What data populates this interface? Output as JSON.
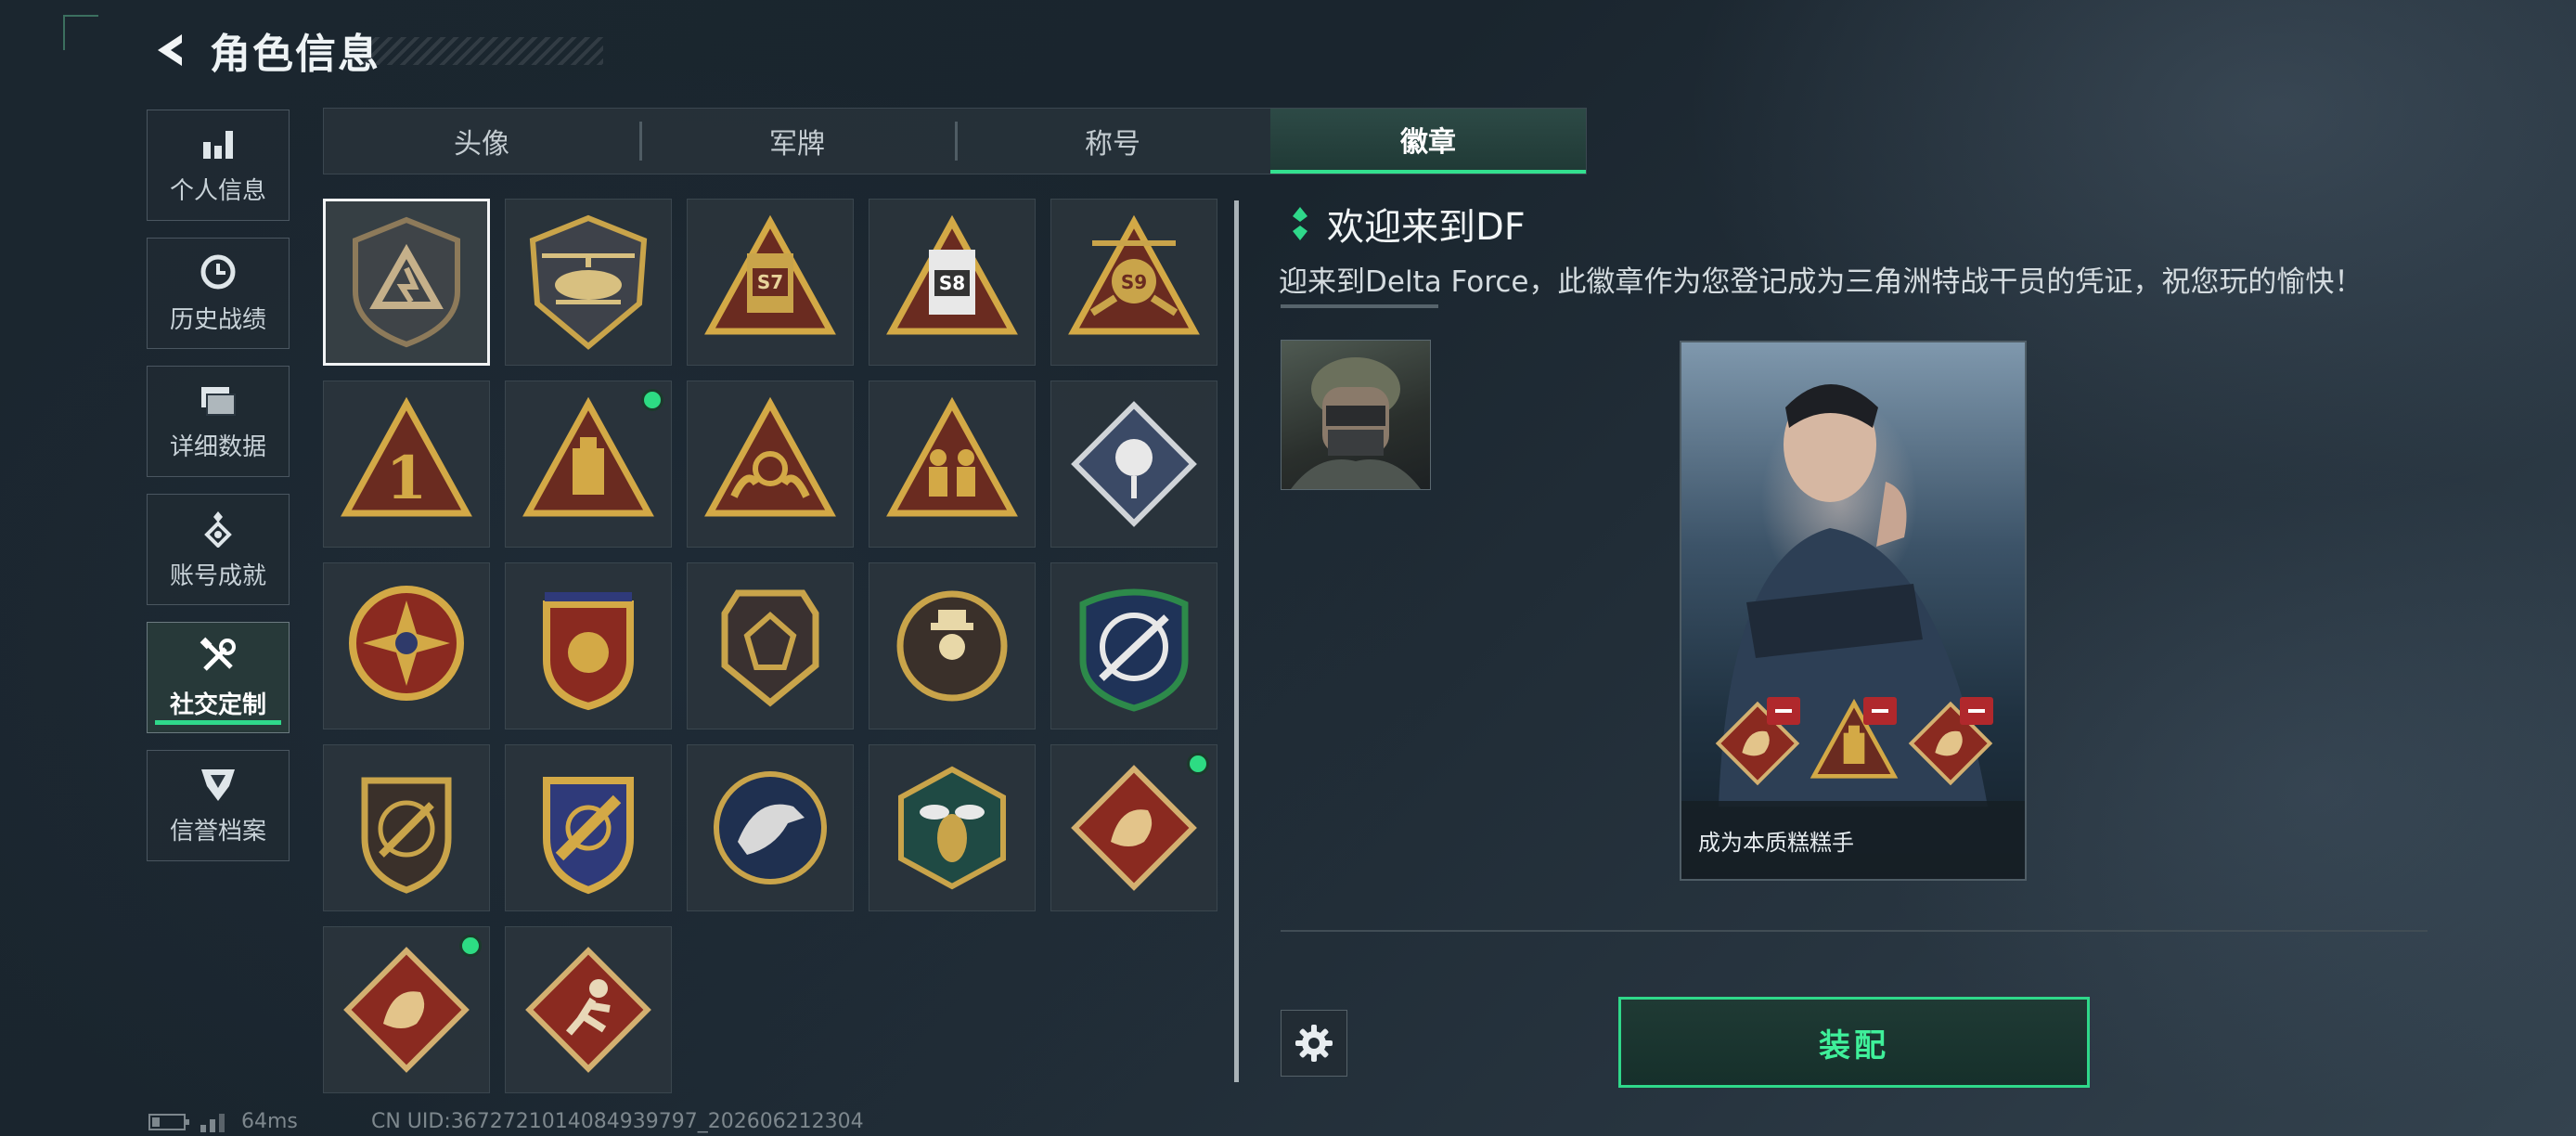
{
  "header": {
    "title": "角色信息"
  },
  "sidebar": {
    "items": [
      {
        "label": "个人信息",
        "icon": "bar-chart-icon"
      },
      {
        "label": "历史战绩",
        "icon": "history-clock-icon"
      },
      {
        "label": "详细数据",
        "icon": "folder-icon"
      },
      {
        "label": "账号成就",
        "icon": "achievement-icon"
      },
      {
        "label": "社交定制",
        "icon": "tools-icon",
        "active": true
      },
      {
        "label": "信誉档案",
        "icon": "shield-emblem-icon"
      }
    ]
  },
  "tabs": [
    {
      "label": "头像"
    },
    {
      "label": "军牌"
    },
    {
      "label": "称号"
    },
    {
      "label": "徽章",
      "active": true
    }
  ],
  "badges": [
    {
      "name": "delta-force-welcome-badge",
      "selected": true,
      "new": false
    },
    {
      "name": "helicopter-badge",
      "new": false
    },
    {
      "name": "s7-badge",
      "text": "S7",
      "new": false
    },
    {
      "name": "s8-badge",
      "text": "S8",
      "new": false
    },
    {
      "name": "s9-badge",
      "text": "S9",
      "new": false
    },
    {
      "name": "rank-1-badge",
      "text": "1",
      "new": false
    },
    {
      "name": "usb-triangle-badge",
      "new": true
    },
    {
      "name": "hands-triangle-badge",
      "new": false
    },
    {
      "name": "soldiers-triangle-badge",
      "new": false
    },
    {
      "name": "rose-diamond-badge",
      "new": false
    },
    {
      "name": "star-compass-badge",
      "new": false
    },
    {
      "name": "winged-crest-badge",
      "new": false
    },
    {
      "name": "gem-shield-badge",
      "new": false
    },
    {
      "name": "hat-figure-badge",
      "new": false
    },
    {
      "name": "crosshair-rifle-badge",
      "new": false
    },
    {
      "name": "rifle-shield-badge",
      "new": false
    },
    {
      "name": "rocket-crest-badge",
      "new": false
    },
    {
      "name": "eagle-badge",
      "new": false
    },
    {
      "name": "wasp-badge",
      "new": false
    },
    {
      "name": "dragon-badge",
      "new": true
    },
    {
      "name": "dragon-badge-2",
      "new": true
    },
    {
      "name": "runner-badge",
      "new": false
    }
  ],
  "detail": {
    "title": "欢迎来到DF",
    "description": "迎来到Delta Force，此徽章作为您登记成为三角洲特战干员的凭证，祝您玩的愉快！",
    "preview_caption": "成为本质糕糕手",
    "equip_label": "装配"
  },
  "status": {
    "ping": "64ms",
    "uid": "CN UID:3672721014084939797_202606212304"
  },
  "colors": {
    "accent": "#2fd88a",
    "badge_gold": "#c9a44a",
    "badge_red": "#8a2a20"
  }
}
